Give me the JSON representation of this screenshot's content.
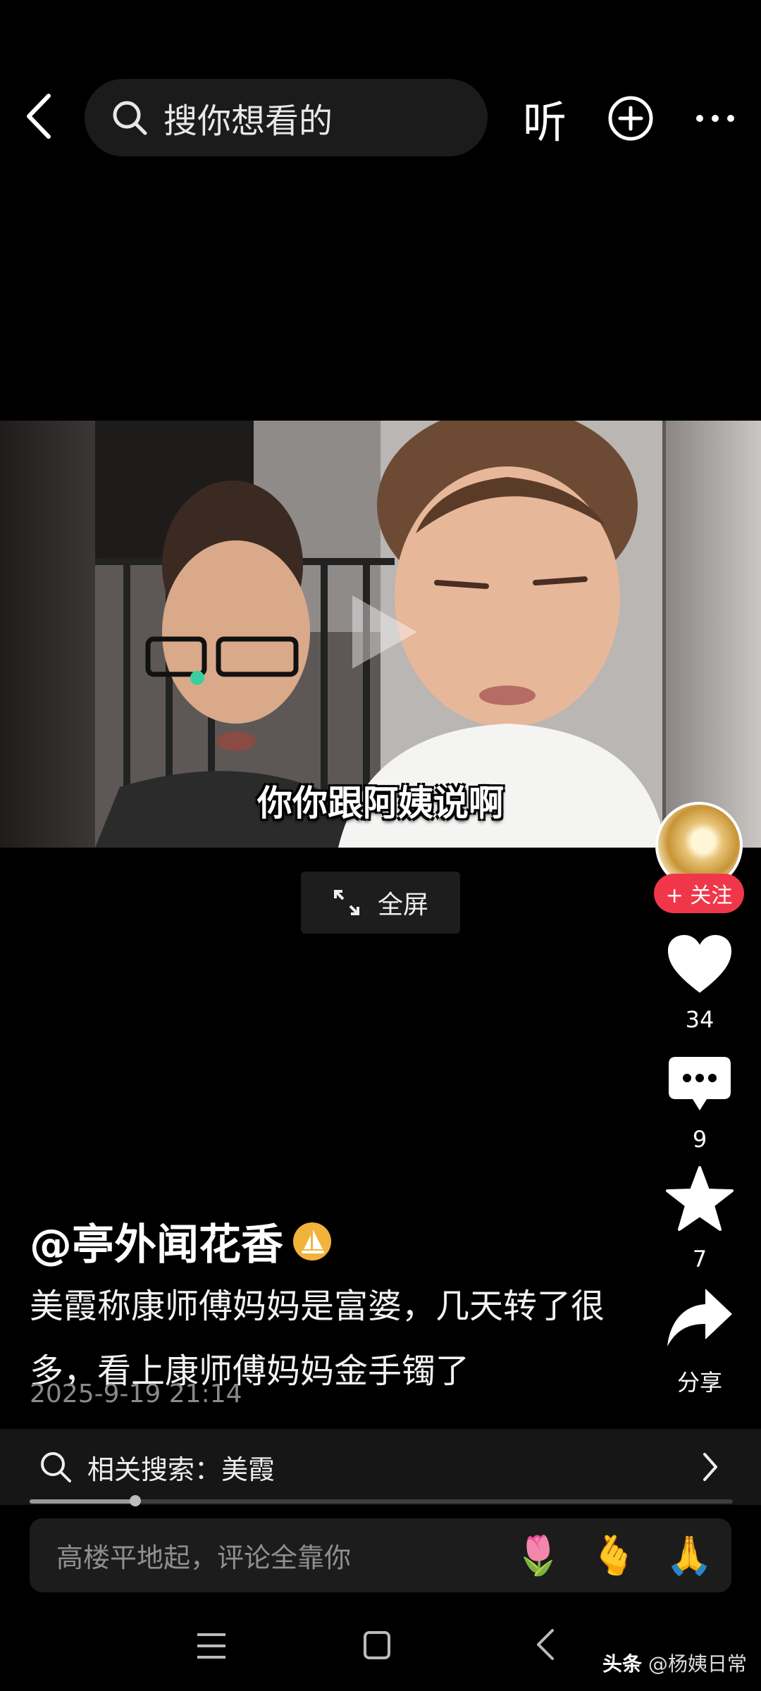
{
  "topbar": {
    "search_placeholder": "搜你想看的",
    "listen_label": "听"
  },
  "video": {
    "caption": "你你跟阿姨说啊",
    "fullscreen_label": "全屏"
  },
  "side": {
    "follow_label": "+ 关注",
    "likes": "34",
    "comments": "9",
    "favorites": "7",
    "share_label": "分享"
  },
  "post": {
    "author": "@亭外闻花香",
    "description": "美霞称康师傅妈妈是富婆，几天转了很多，看上康师傅妈妈金手镯了",
    "timestamp": "2025-9-19 21:14"
  },
  "related": {
    "label": "相关搜索：美霞"
  },
  "playback": {
    "progress": 0.15
  },
  "comment_bar": {
    "placeholder": "高楼平地起，评论全靠你",
    "emojis": [
      "🌷",
      "🫰",
      "🙏"
    ]
  },
  "watermark": {
    "brand": "头条",
    "account": "@杨姨日常"
  },
  "colors": {
    "follow_button": "#f0374a",
    "verified_badge": "#f2b33a"
  }
}
